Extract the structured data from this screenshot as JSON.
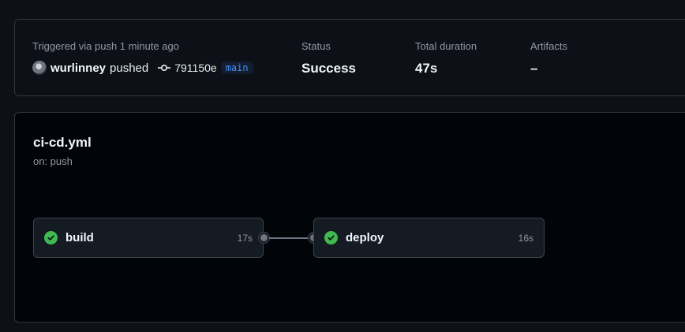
{
  "run": {
    "triggered_text": "Triggered via push 1 minute ago",
    "user": "wurlinney",
    "action": "pushed",
    "commit_sha": "791150e",
    "branch": "main"
  },
  "status": {
    "label": "Status",
    "value": "Success"
  },
  "duration": {
    "label": "Total duration",
    "value": "47s"
  },
  "artifacts": {
    "label": "Artifacts",
    "value": "–"
  },
  "workflow": {
    "file": "ci-cd.yml",
    "trigger": "on: push",
    "jobs": [
      {
        "name": "build",
        "duration": "17s",
        "status": "success"
      },
      {
        "name": "deploy",
        "duration": "16s",
        "status": "success"
      }
    ]
  },
  "colors": {
    "success": "#3fb950",
    "branch": "#4493f8",
    "background": "#0d1117"
  },
  "icons": {
    "commit": "git-commit-icon",
    "check": "check-circle-icon"
  }
}
